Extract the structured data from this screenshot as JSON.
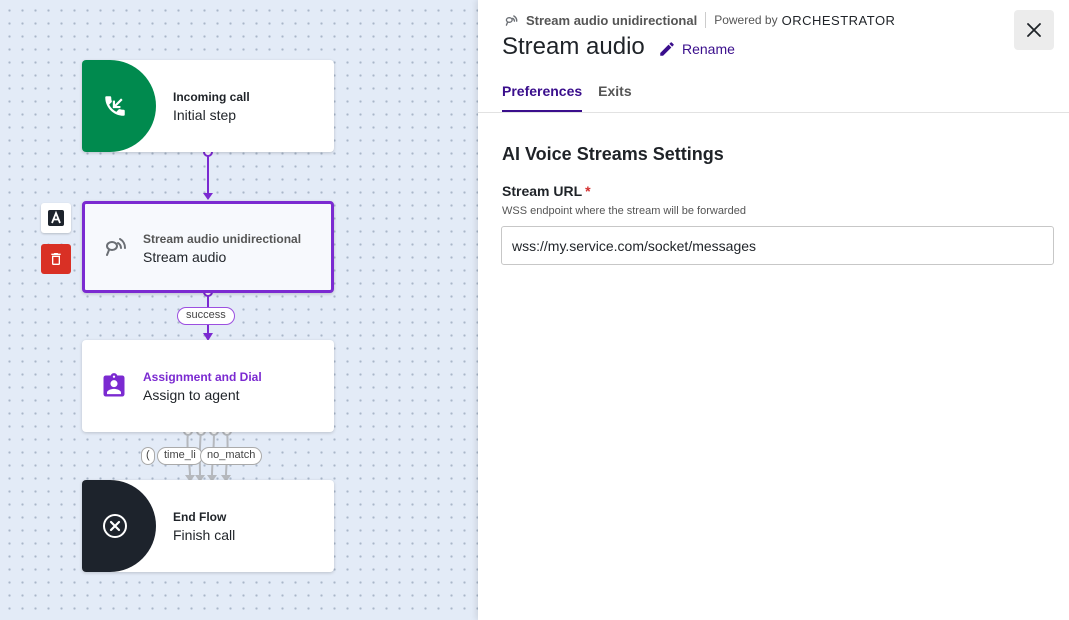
{
  "flow": {
    "nodes": [
      {
        "id": "incoming",
        "sub": "Incoming call",
        "main": "Initial step",
        "color": "#008a4e",
        "icon": "incoming-call-icon"
      },
      {
        "id": "stream",
        "sub": "Stream audio unidirectional",
        "main": "Stream audio",
        "color": "#7b2ad1",
        "icon": "stream-audio-icon"
      },
      {
        "id": "assign",
        "sub": "Assignment and Dial",
        "main": "Assign to agent",
        "color": "#7b2ad1",
        "icon": "assign-agent-icon"
      },
      {
        "id": "end",
        "sub": "End Flow",
        "main": "Finish call",
        "color": "#1d232c",
        "icon": "close-circle-icon"
      }
    ],
    "edge_labels": {
      "success": "success",
      "partial": "(",
      "time": "time_li",
      "no_match": "no_match"
    },
    "toolbar": {
      "format_icon": "format-a-icon",
      "delete_icon": "trash-icon",
      "delete_color": "#d93025"
    }
  },
  "panel": {
    "type_label": "Stream audio unidirectional",
    "powered_by": "Powered by",
    "brand": "ORCHESTRATOR",
    "title": "Stream audio",
    "rename_label": "Rename",
    "tabs": [
      {
        "label": "Preferences",
        "active": true
      },
      {
        "label": "Exits",
        "active": false
      }
    ],
    "section_title": "AI Voice Streams Settings",
    "field": {
      "label": "Stream URL",
      "required_mark": "*",
      "help": "WSS endpoint where the stream will be forwarded",
      "value": "wss://my.service.com/socket/messages"
    },
    "accent": "#3a0e8c"
  }
}
